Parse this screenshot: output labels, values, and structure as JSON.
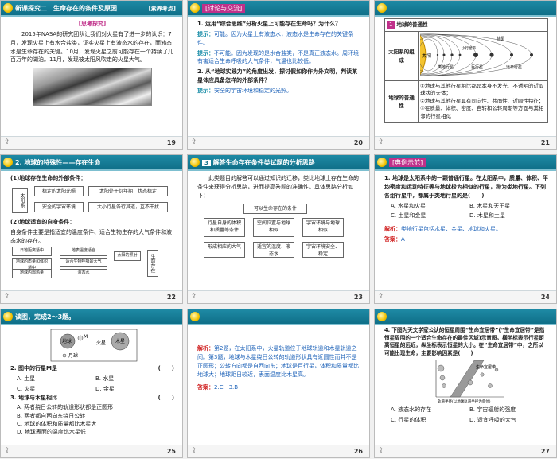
{
  "s19": {
    "title": "新课探究二　生命存在的条件及原因",
    "tag": "[素养考点]",
    "label": "[思考探究]",
    "text": "2015年NASA的研究团队让我们对火星有了进一步的认识：7月，发现火星上有水合盐类，证实火星上有液态水的存在，而液态水是生命存在的关键。10月，发现火星之前可能存在一个持续了几百万年的湖泊。11月，发现彼太阳风吹走的火星大气。",
    "page": "19"
  },
  "s20": {
    "label": "[讨论与交流]",
    "q1": "1. 运用“综合思维”分析火星上可能存在生命吗？为什么？",
    "a1_label": "提示：",
    "a1": "可能。因为火星上有液态水，液态水是生命存在的关键条件。",
    "a1b_label": "提示：",
    "a1b": "不可能。因为发现的是水合盐类，不是真正液态水。周环境有害适合生命呼吸的大气条件，气温也比较低。",
    "q2": "2. 从“地球实践力”的角度出发，探讨假如你作为外文明，判读某星体应具备怎样的外部条件？",
    "a2_label": "提示：",
    "a2": "安全的宇宙环境和稳定的光照。",
    "page": "20"
  },
  "s21": {
    "chip": "1",
    "heading": "地球的普通性",
    "row1_label": "太阳系的组成",
    "diagram_labels": [
      "太阳",
      "水星",
      "金星",
      "地球",
      "火星",
      "小行星带",
      "木星",
      "土星",
      "天王星",
      "海王星",
      "彗星",
      "类地行星",
      "巨行星",
      "远日行星"
    ],
    "row2_label": "地球的普通性",
    "row2_items": [
      "①地球与其他行星相比都是本身不发光、不透明的近似球状的天体；",
      "②地球与其他行星具有同向性、共面性、近圆性特征；",
      "③在质量、体积、密度、自转和公转周期等方面与其相邻的行星相似"
    ],
    "page": "21"
  },
  "s22": {
    "heading": "2. 地球的特殊性——存在生命",
    "sub1": "(1)地球存在生命的外部条件：",
    "ext_root": "太阳系",
    "ext_items": [
      "稳定的太阳光照",
      "太阳处于衍年期，状态稳定",
      "安全的宇宙环境",
      "大小行星各行其道，互不干扰"
    ],
    "sub2": "(2)地球适宜的自身条件：",
    "sub2_text": "自身条件主要是指适宜的温度条件、适合生物生存的大气条件和液态水的存在。",
    "flow_items": [
      "日地距离适中",
      "地表温度适宜",
      "地球的质量和体积适中",
      "适合生物呼吸的大气",
      "地球内部热量",
      "液态水",
      "太阳的照射"
    ],
    "flow_result": "生命存在",
    "page": "22"
  },
  "s23": {
    "chip": "3",
    "heading": "解答生命存在条件类试题的分析思路",
    "text": "此类题目的解答可以通过知识的迁移，类比地球上存在生命的条件来获得分析思路，进而提高答题的准确性。具体思路分析如下：",
    "root": "可以生命存在的条件",
    "top_boxes": [
      "行星自身的体积和质量等条件",
      "空间位置与地球相似",
      "宇宙环境与地球相似"
    ],
    "bottom_boxes": [
      "形成相应的大气",
      "适宜的温度、液态水",
      "宇宙环境安全、稳定"
    ],
    "page": "23"
  },
  "s24": {
    "label": "[典例示范]",
    "q": "1. 地球是太阳系中的一颗普通行星。在太阳系中，质量、体积、平均密度和运动特征等与地球极为相似的行星，称为类地行星。下列各组行星中，都属于类地行星的是(　　)",
    "options": [
      "A. 水星和火星",
      "B. 木星和天王星",
      "C. 土星和金星",
      "D. 木星和土星"
    ],
    "ans_label": "解析：",
    "ans_text": "类地行星包括水星、金星、地球和火星。",
    "key_label": "答案：",
    "key": "A",
    "page": "24"
  },
  "s25": {
    "intro": "读图，完成2～3题。",
    "diagram_labels": [
      "地球",
      "M",
      "火星",
      "木星",
      "月球"
    ],
    "q2": "2. 图中的行星M是",
    "q2_paren": "(　　)",
    "q2_opts": [
      "A. 土星",
      "B. 水星",
      "C. 火星",
      "D. 金星"
    ],
    "q3": "3. 地球与木星相比",
    "q3_paren": "(　　)",
    "q3_opts": [
      "A. 两者绕日公转的轨道形状都是正圆形",
      "B. 两者都自西向东绕日公转",
      "C. 地球的体积和质量都比木星大",
      "D. 地球表面的温度比木星低"
    ],
    "page": "25"
  },
  "s26": {
    "ans_label": "解析：",
    "text": "第2题，在太阳系中，火星轨道位于地球轨道和木星轨道之间。第3题，地球与木星绕日公转的轨道形状具有近圆性而并不是正圆形；公转方向都是自西向东；地球是巨行星，体积和质量都比地球大；地球距日较近，表面温度比木星高。",
    "key_label": "答案：",
    "key": "2.C　3.B",
    "page": "26"
  },
  "s27": {
    "q": "4. 下图为天文学家公认的恒星周围“生命宜居带”(“生命宜居带”是指恒星周围的一个适合生命存在的最佳区域)示意图。横坐标表示行星距离恒星的远近，纵坐标表示恒星的大小。在“生命宜居带”中，之所以可能出现生命，主要影响因素是",
    "paren": "(　　)",
    "chart_axis_x": "轨道半径(以地球轨道半径为单位)",
    "chart_axis_y": "恒星质量(以太阳质量为单位)",
    "chart_band": "生命宜居带",
    "options": [
      "A. 液态水的存在",
      "B. 宇宙辐射的强度",
      "C. 行星的体积",
      "D. 适宜呼吸的大气"
    ],
    "page": "27"
  }
}
